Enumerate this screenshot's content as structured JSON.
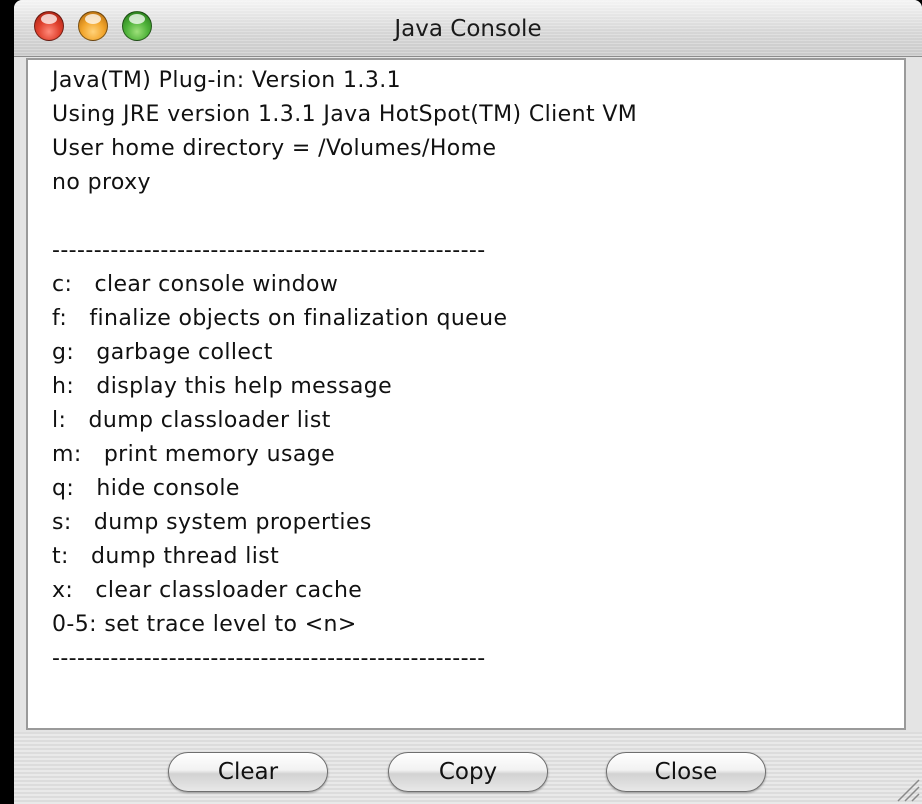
{
  "window": {
    "title": "Java Console"
  },
  "console": {
    "lines": [
      "Java(TM) Plug-in: Version 1.3.1",
      "Using JRE version 1.3.1 Java HotSpot(TM) Client VM",
      "User home directory = /Volumes/Home",
      "no proxy",
      "",
      "----------------------------------------------------",
      "c:   clear console window",
      "f:   finalize objects on finalization queue",
      "g:   garbage collect",
      "h:   display this help message",
      "l:   dump classloader list",
      "m:   print memory usage",
      "q:   hide console",
      "s:   dump system properties",
      "t:   dump thread list",
      "x:   clear classloader cache",
      "0-5: set trace level to <n>",
      "----------------------------------------------------"
    ]
  },
  "buttons": {
    "clear": "Clear",
    "copy": "Copy",
    "close": "Close"
  },
  "icons": {
    "close": "close-button-icon",
    "minimize": "minimize-button-icon",
    "zoom": "zoom-button-icon",
    "resize": "resize-grip-icon"
  }
}
